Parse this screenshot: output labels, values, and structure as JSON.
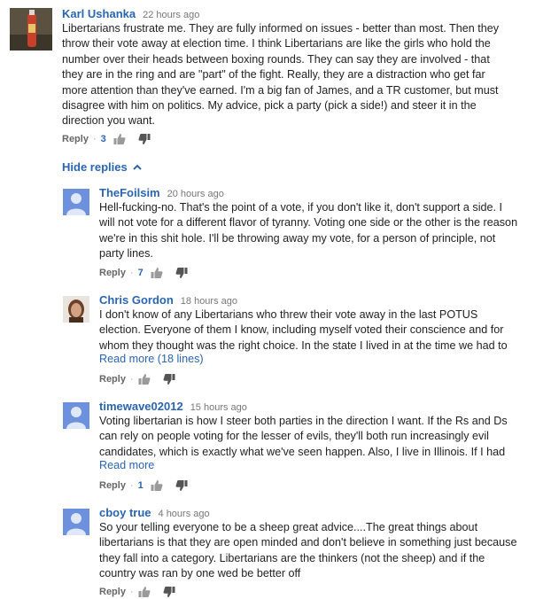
{
  "top_comment": {
    "author": "Karl Ushanka",
    "time": "22 hours ago",
    "lines": [
      "Libertarians frustrate me.  They are fully informed on issues - better than most.  Then they",
      "throw their vote away at election time.  I think Libertarians are like the girls who hold the",
      "number over their heads between boxing rounds.  They can say they are involved - that",
      "they are in the ring and are \"part\" of the fight.  Really, they are a distraction who get far",
      "more attention than they've earned.  I'm a big fan of James, and a TR customer, but must",
      "disagree with him on politics.  My advice, pick a party (pick a side!) and steer it in the",
      "direction you want."
    ],
    "reply_label": "Reply",
    "likes": "3"
  },
  "hide_replies_label": "Hide replies",
  "replies": [
    {
      "author": "TheFoilsim",
      "time": "20 hours ago",
      "lines": [
        "Hell-fucking-no. That's the point of a vote, if you don't like it, don't support a side. I",
        "will not vote for a different flavor of tyranny. Voting one side or the other is the reason",
        "we're in this shit hole. I'll be throwing away my vote, for a person of principle, not",
        "party lines."
      ],
      "reply_label": "Reply",
      "likes": "7"
    },
    {
      "author": "Chris Gordon",
      "time": "18 hours ago",
      "lines": [
        "I don't know of any Libertarians who threw their vote away in the last POTUS",
        "election. Everyone of them I know, including myself voted their conscience and for",
        "whom they thought was the right choice. In the state I lived in at the time we had to"
      ],
      "read_more": "Read more (18 lines)",
      "reply_label": "Reply",
      "likes": ""
    },
    {
      "author": "timewave02012",
      "time": "15 hours ago",
      "lines": [
        "Voting libertarian is how I steer both parties in the direction I want. If the Rs and Ds",
        "can rely on people voting for the lesser of evils, they'll both run increasingly evil",
        "candidates, which is exactly what we've seen happen. Also, I live in Illinois. If I had"
      ],
      "read_more": "Read more",
      "reply_label": "Reply",
      "likes": "1"
    },
    {
      "author": "cboy true",
      "time": "4 hours ago",
      "lines": [
        "So your telling everyone to be a sheep great advice....The great things about",
        "libertarians is that they are open minded and don't believe in something just because",
        "they fall into a category. Libertarians are the thinkers (not the sheep) and if the",
        "country was ran by one wed be better off"
      ],
      "reply_label": "Reply",
      "likes": ""
    }
  ]
}
